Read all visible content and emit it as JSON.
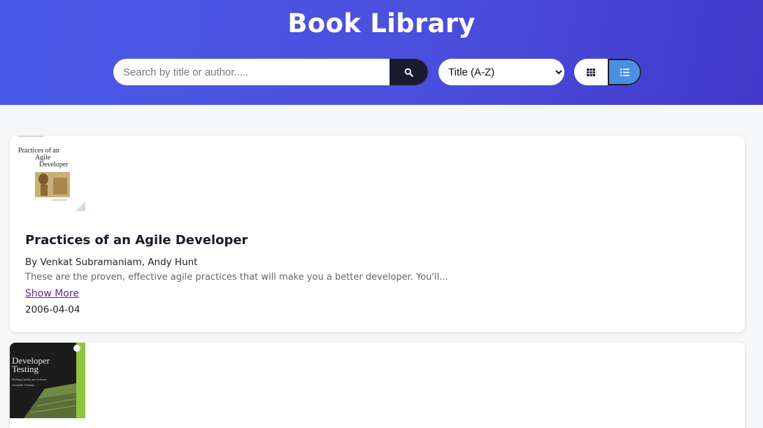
{
  "header": {
    "title": "Book Library",
    "search_placeholder": "Search by title or author.....",
    "search_icon": "search-icon",
    "sort_selected": "Title (A-Z)",
    "view_modes": [
      "grid-icon",
      "list-icon"
    ],
    "active_view": "list"
  },
  "books": [
    {
      "title": "Practices of an Agile Developer",
      "author": "By Venkat Subramaniam, Andy Hunt",
      "description": "These are the proven, effective agile practices that will make you a better developer. You'll...",
      "show_more": "Show More",
      "date": "2006-04-04",
      "cover_text": [
        "Practices of an",
        "Agile",
        "Developer"
      ]
    },
    {
      "cover_text": [
        "Developer",
        "Testing",
        "Building Quality into Software",
        "Alexander Tarlinder"
      ]
    }
  ],
  "colors": {
    "header_start": "#4a5ae6",
    "header_end": "#4338c9",
    "search_button": "#1b1b2f",
    "active_view": "#4a90e2",
    "link": "#5b2a86"
  }
}
